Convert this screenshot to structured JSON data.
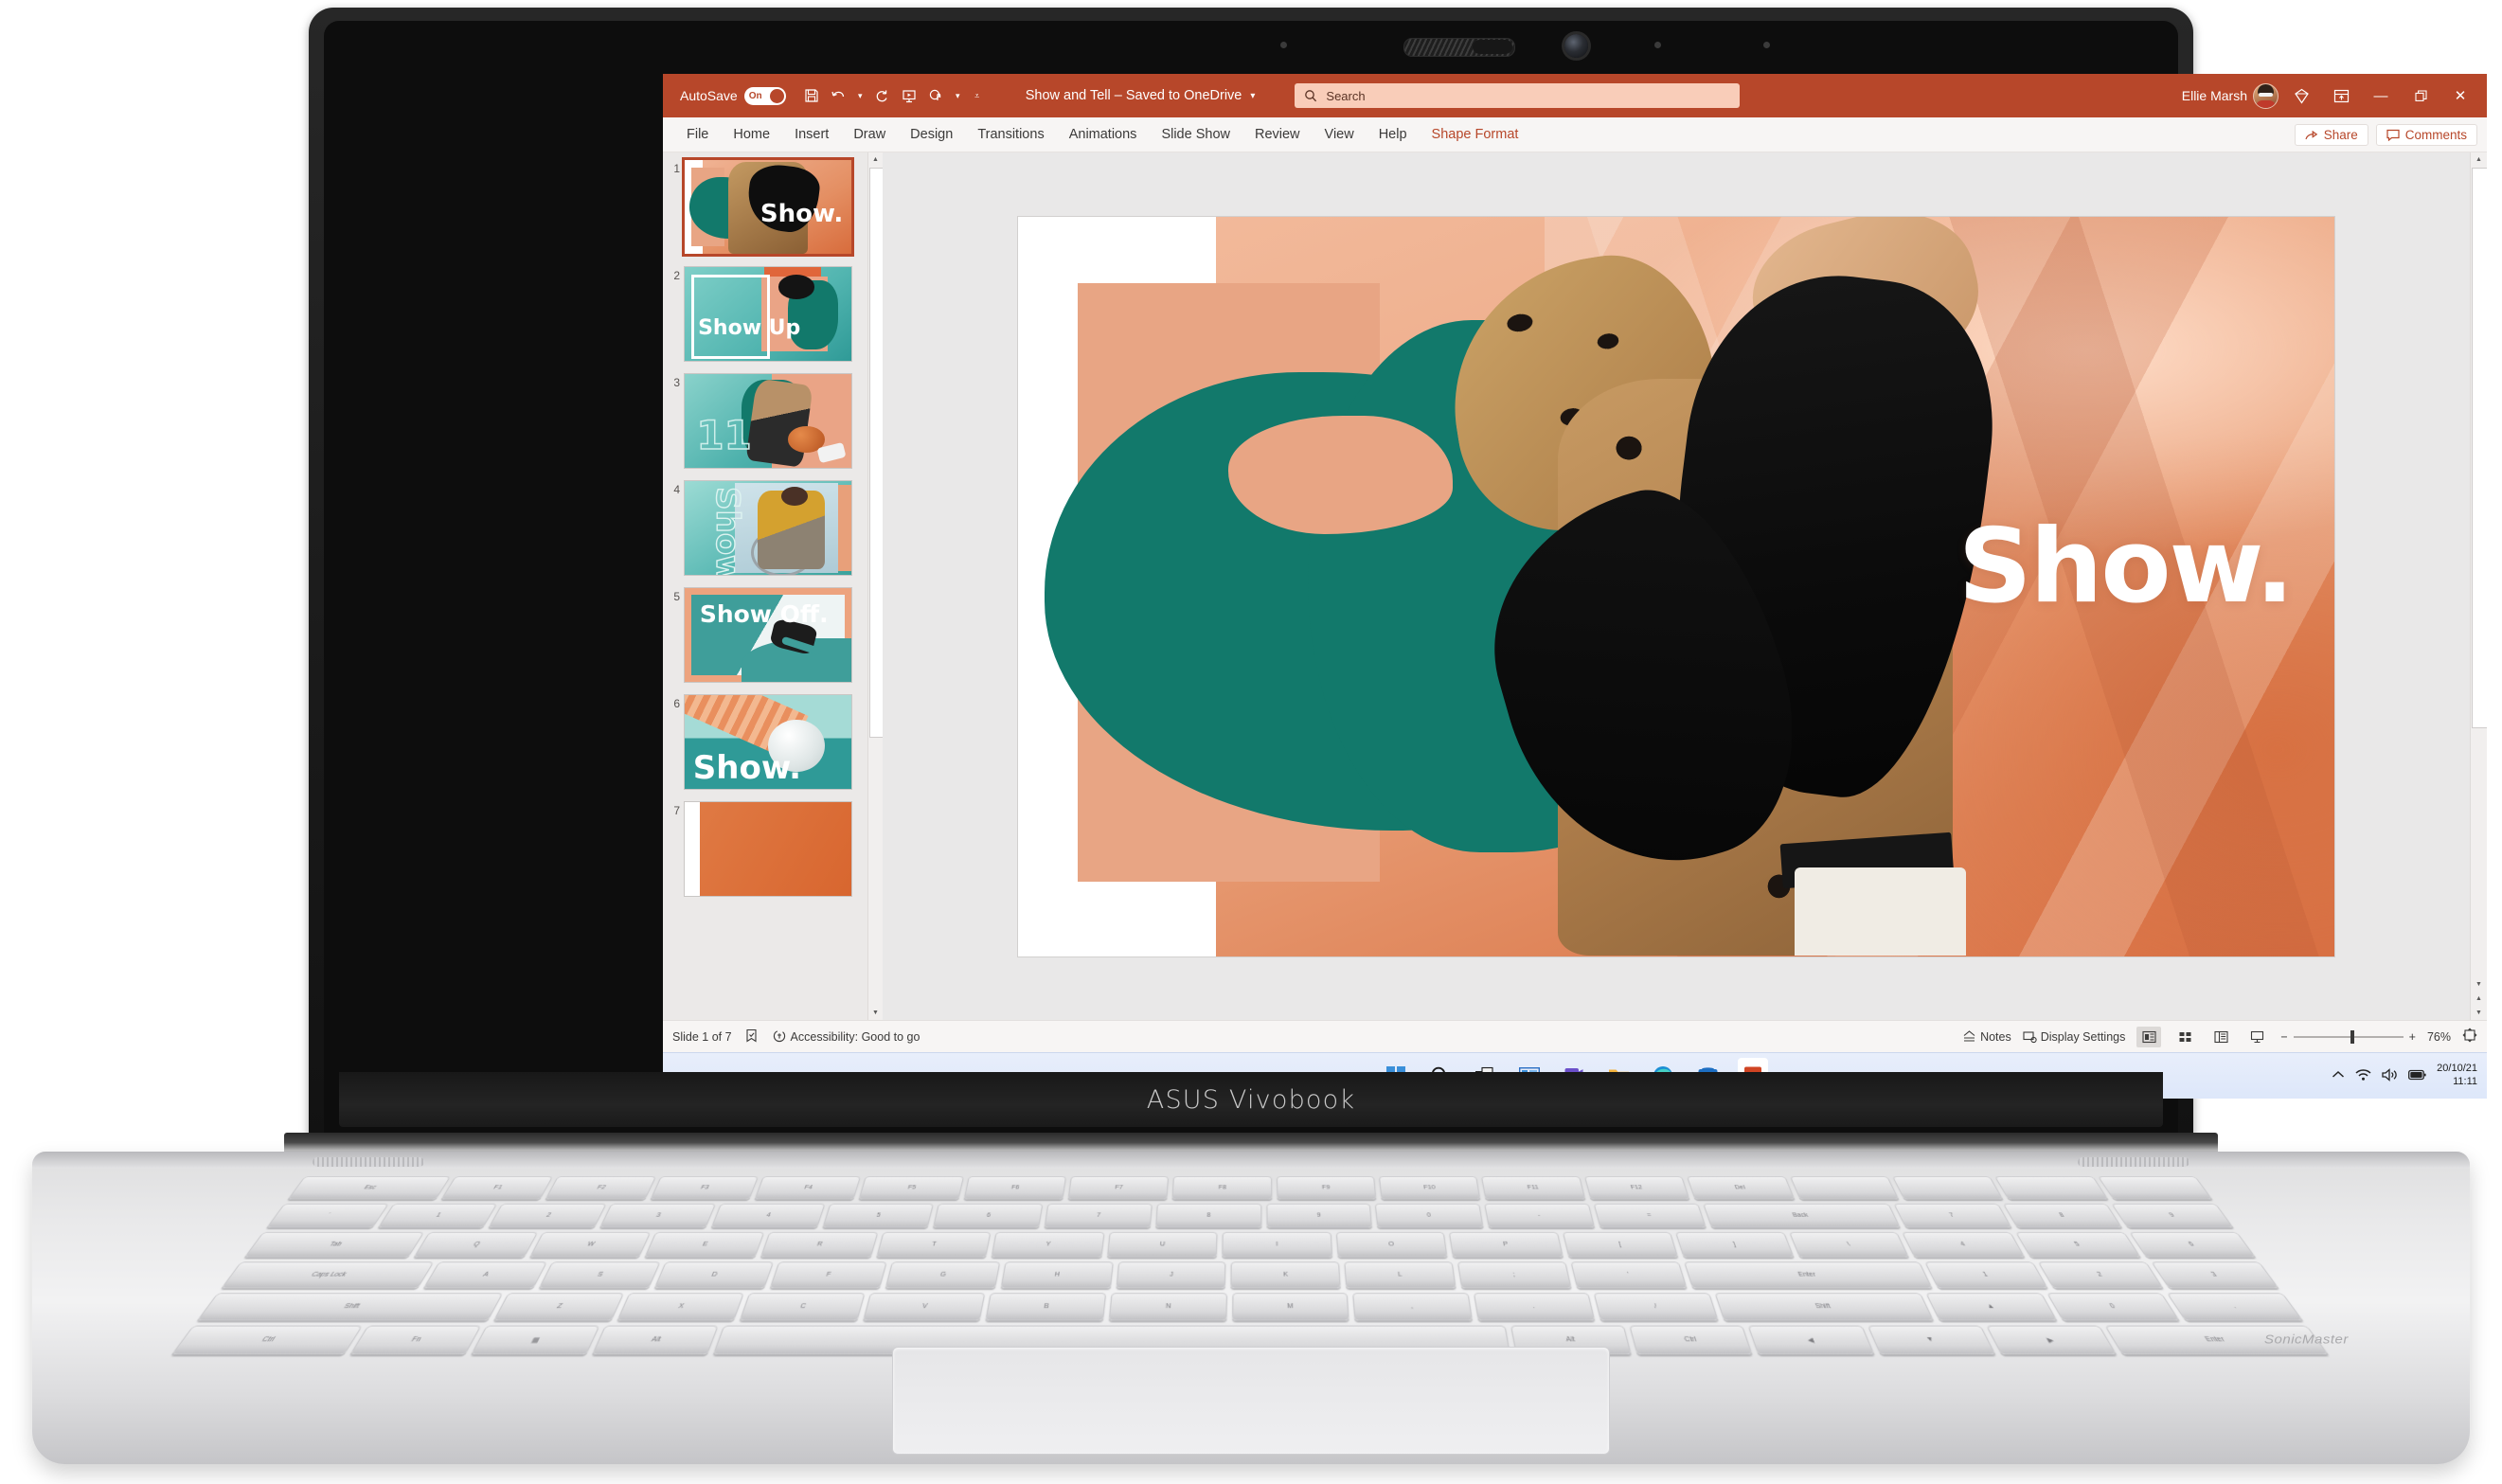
{
  "device": {
    "brand": "ASUS Vivobook",
    "audio_brand": "SonicMaster"
  },
  "titlebar": {
    "autosave_label": "AutoSave",
    "autosave_state": "On",
    "document_title": "Show and Tell – Saved to OneDrive",
    "user_name": "Ellie Marsh",
    "quick_access": [
      {
        "name": "save-icon",
        "glyph": "💾"
      },
      {
        "name": "undo-icon",
        "glyph": "↶"
      },
      {
        "name": "redo-icon",
        "glyph": "↻"
      },
      {
        "name": "start-presentation-icon",
        "glyph": "⬜"
      },
      {
        "name": "touch-mode-icon",
        "glyph": "☝"
      }
    ],
    "window_controls": {
      "minimize": "—",
      "restore": "❐",
      "close": "✕"
    },
    "accent_color": "#b7472a"
  },
  "search": {
    "placeholder": "Search"
  },
  "ribbon": {
    "tabs": [
      {
        "label": "File",
        "contextual": false
      },
      {
        "label": "Home",
        "contextual": false
      },
      {
        "label": "Insert",
        "contextual": false
      },
      {
        "label": "Draw",
        "contextual": false
      },
      {
        "label": "Design",
        "contextual": false
      },
      {
        "label": "Transitions",
        "contextual": false
      },
      {
        "label": "Animations",
        "contextual": false
      },
      {
        "label": "Slide Show",
        "contextual": false
      },
      {
        "label": "Review",
        "contextual": false
      },
      {
        "label": "View",
        "contextual": false
      },
      {
        "label": "Help",
        "contextual": false
      },
      {
        "label": "Shape Format",
        "contextual": true
      }
    ],
    "share_label": "Share",
    "comments_label": "Comments"
  },
  "slides": [
    {
      "number": "1",
      "title": "Show.",
      "selected": true
    },
    {
      "number": "2",
      "title": "Show Up",
      "selected": false
    },
    {
      "number": "3",
      "title": "11",
      "selected": false
    },
    {
      "number": "4",
      "title": "Show",
      "selected": false
    },
    {
      "number": "5",
      "title": "Show Off.",
      "selected": false
    },
    {
      "number": "6",
      "title": "Show.",
      "selected": false
    },
    {
      "number": "7",
      "title": "",
      "selected": false
    }
  ],
  "current_slide": {
    "headline": "Show."
  },
  "statusbar": {
    "slide_counter": "Slide 1 of 7",
    "accessibility": "Accessibility: Good to go",
    "notes_label": "Notes",
    "display_settings_label": "Display Settings",
    "zoom_level": "76%",
    "zoom_minus": "−",
    "zoom_plus": "+"
  },
  "taskbar": {
    "items": [
      {
        "name": "start-icon",
        "label": "Start"
      },
      {
        "name": "search-icon",
        "label": "Search"
      },
      {
        "name": "task-view-icon",
        "label": "Task View"
      },
      {
        "name": "widgets-icon",
        "label": "Widgets"
      },
      {
        "name": "teams-icon",
        "label": "Chat"
      },
      {
        "name": "file-explorer-icon",
        "label": "File Explorer"
      },
      {
        "name": "edge-icon",
        "label": "Microsoft Edge"
      },
      {
        "name": "microsoft-store-icon",
        "label": "Microsoft Store"
      },
      {
        "name": "powerpoint-icon",
        "label": "PowerPoint"
      }
    ],
    "tray": {
      "date": "20/10/21",
      "time": "11:11"
    }
  }
}
